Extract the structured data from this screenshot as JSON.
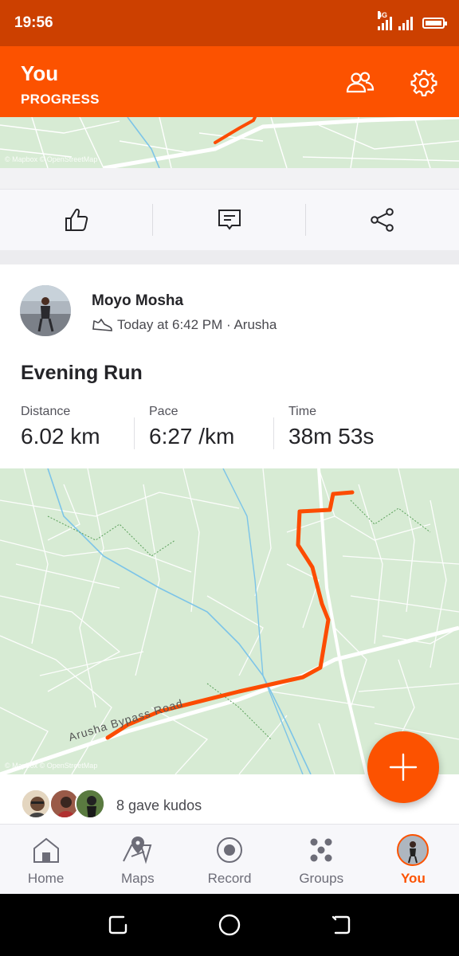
{
  "status_bar": {
    "time": "19:56",
    "network_label": "4G"
  },
  "header": {
    "title": "You",
    "subtitle": "PROGRESS",
    "friends_icon": "friends-icon",
    "settings_icon": "gear-icon"
  },
  "prev_card": {
    "map_attribution": "© Mapbox © OpenStreetMap",
    "actions": [
      {
        "icon": "thumbs-up-icon"
      },
      {
        "icon": "comment-icon"
      },
      {
        "icon": "share-icon"
      }
    ]
  },
  "activity": {
    "athlete_name": "Moyo Mosha",
    "meta": "Today at 6:42 PM · Arusha",
    "title": "Evening Run",
    "stats": [
      {
        "label": "Distance",
        "value": "6.02 km"
      },
      {
        "label": "Pace",
        "value": "6:27 /km"
      },
      {
        "label": "Time",
        "value": "38m 53s"
      }
    ],
    "map_attribution": "© Mapbox © OpenStreetMap",
    "road_label": "Arusha Bypass Road",
    "kudos_text": "8 gave kudos",
    "route_color": "#fc4c02"
  },
  "bottom_nav": {
    "items": [
      {
        "label": "Home",
        "icon": "home-icon",
        "active": false
      },
      {
        "label": "Maps",
        "icon": "maps-icon",
        "active": false
      },
      {
        "label": "Record",
        "icon": "record-icon",
        "active": false
      },
      {
        "label": "Groups",
        "icon": "groups-icon",
        "active": false
      },
      {
        "label": "You",
        "icon": "avatar",
        "active": true
      }
    ]
  },
  "colors": {
    "brand": "#fc5200",
    "status_bar": "#cc4000",
    "map_bg": "#d7ebd4"
  }
}
